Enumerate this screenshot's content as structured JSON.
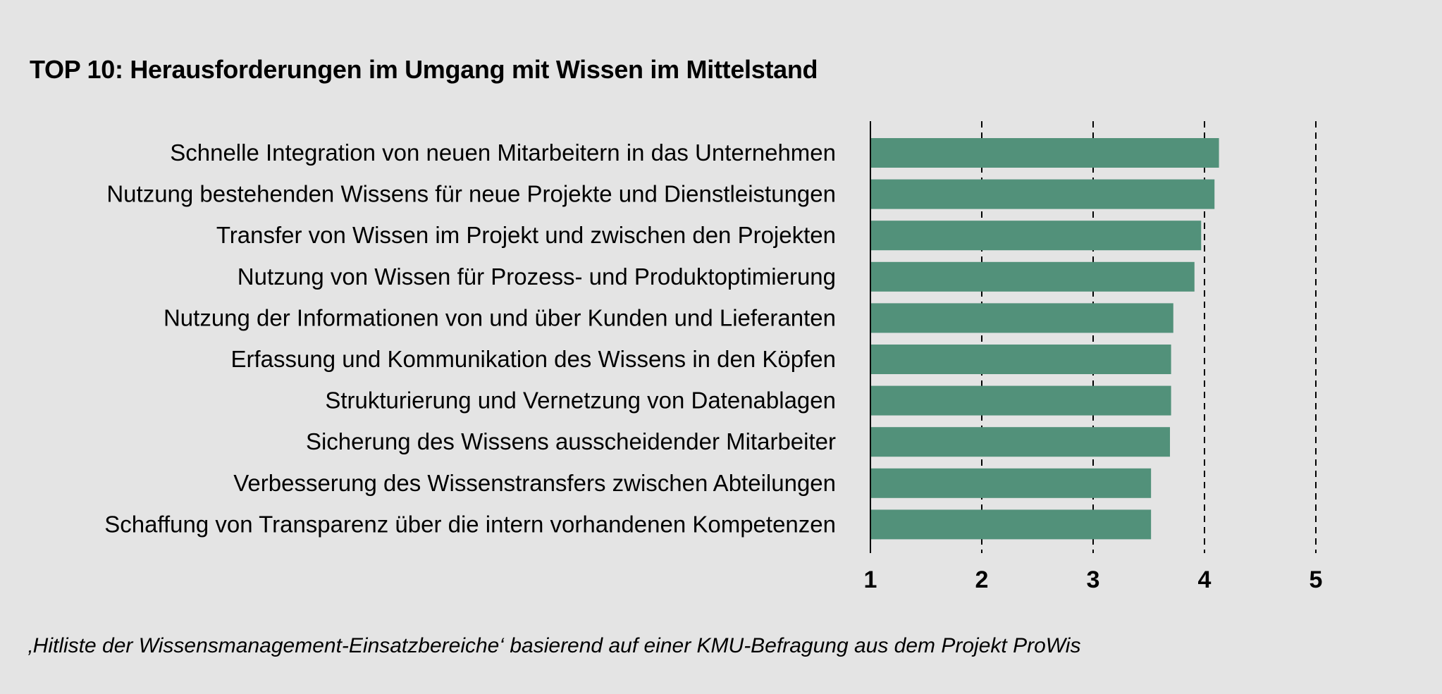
{
  "chart_data": {
    "type": "bar",
    "orientation": "horizontal",
    "title": "TOP 10: Herausforderungen im Umgang mit Wissen im Mittelstand",
    "caption": "‚Hitliste der Wissensmanagement-Einsatzbereiche‘ basierend auf einer KMU-Befragung aus dem Projekt ProWis",
    "categories": [
      "Schnelle Integration von neuen Mitarbeitern in das Unternehmen",
      "Nutzung bestehenden Wissens für neue Projekte und Dienstleistungen",
      "Transfer von Wissen im Projekt und zwischen den Projekten",
      "Nutzung von Wissen für Prozess- und Produktoptimierung",
      "Nutzung der Informationen von und über Kunden und Lieferanten",
      "Erfassung und Kommunikation des Wissens in den Köpfen",
      "Strukturierung und Vernetzung von Datenablagen",
      "Sicherung des Wissens ausscheidender Mitarbeiter",
      "Verbesserung des Wissenstransfers zwischen Abteilungen",
      "Schaffung von Transparenz über die intern vorhandenen Kompetenzen"
    ],
    "values": [
      4.13,
      4.09,
      3.97,
      3.91,
      3.72,
      3.7,
      3.7,
      3.69,
      3.52,
      3.52
    ],
    "xlim": [
      1,
      5
    ],
    "ticks": [
      "1",
      "2",
      "3",
      "4",
      "5"
    ],
    "grid": "dashed vertical",
    "bar_color": "#52917a"
  }
}
